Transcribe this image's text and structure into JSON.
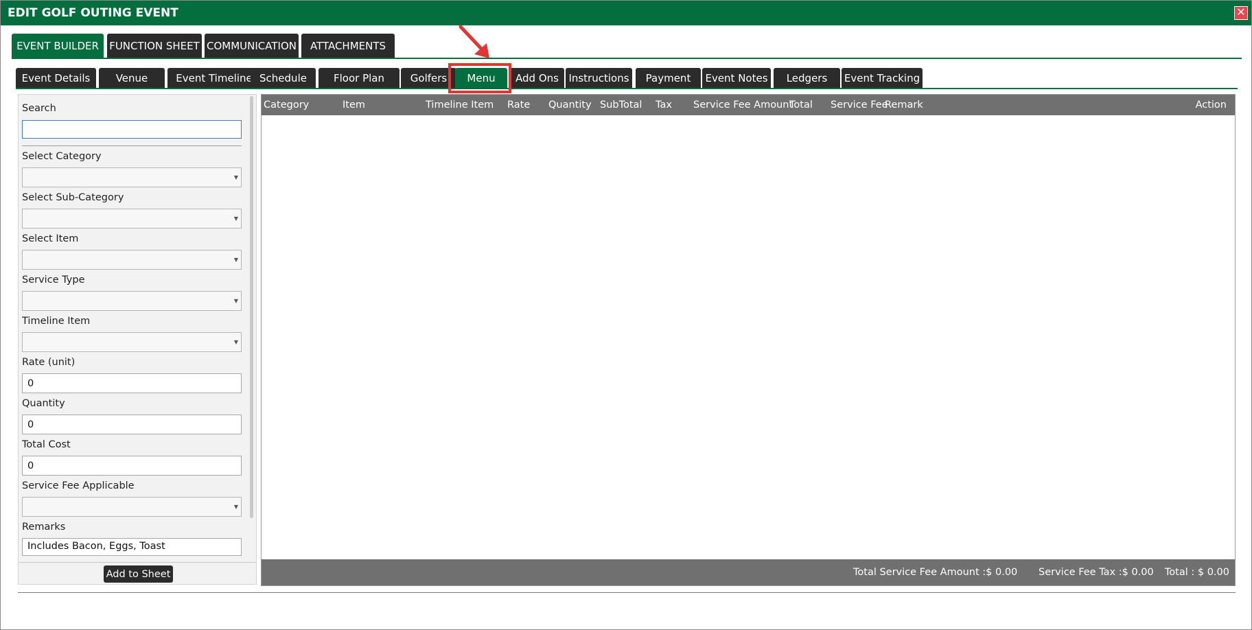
{
  "window": {
    "title": "EDIT GOLF OUTING EVENT",
    "close_glyph": "✕"
  },
  "main_tabs": [
    {
      "label": "EVENT BUILDER",
      "active": true
    },
    {
      "label": "FUNCTION SHEET",
      "active": false
    },
    {
      "label": "COMMUNICATION",
      "active": false
    },
    {
      "label": "ATTACHMENTS",
      "active": false
    }
  ],
  "sub_tabs": [
    {
      "label": "Event Details"
    },
    {
      "label": "Venue"
    },
    {
      "label": "Event Timeline"
    },
    {
      "label": "Schedule"
    },
    {
      "label": "Floor Plan"
    },
    {
      "label": "Golfers"
    },
    {
      "label": "Menu",
      "active": true
    },
    {
      "label": "Add Ons"
    },
    {
      "label": "Instructions"
    },
    {
      "label": "Payment"
    },
    {
      "label": "Event Notes"
    },
    {
      "label": "Ledgers"
    },
    {
      "label": "Event Tracking"
    }
  ],
  "form": {
    "search_label": "Search",
    "search_value": "",
    "category_label": "Select Category",
    "subcategory_label": "Select Sub-Category",
    "item_label": "Select Item",
    "service_type_label": "Service Type",
    "timeline_item_label": "Timeline Item",
    "rate_label": "Rate (unit)",
    "rate_value": "0",
    "quantity_label": "Quantity",
    "quantity_value": "0",
    "total_cost_label": "Total Cost",
    "total_cost_value": "0",
    "service_fee_label": "Service Fee Applicable",
    "remarks_label": "Remarks",
    "remarks_value": "Includes Bacon, Eggs, Toast",
    "add_button": "Add to Sheet",
    "caret_glyph": "▼"
  },
  "grid": {
    "columns": [
      "Category",
      "Item",
      "Timeline Item",
      "Rate",
      "Quantity",
      "SubTotal",
      "Tax",
      "Service Fee Amount",
      "Total",
      "Service Fee",
      "Remark",
      "Action"
    ],
    "rows": [],
    "footer": {
      "service_fee_amount": "Total Service Fee Amount :$  0.00",
      "service_fee_tax": "Service Fee Tax :$ 0.00",
      "total": "Total :  $ 0.00"
    }
  },
  "colors": {
    "brand_green": "#056e3e",
    "tab_dark": "#2b2b2b",
    "highlight_red": "#e23535",
    "header_gray": "#707070"
  }
}
